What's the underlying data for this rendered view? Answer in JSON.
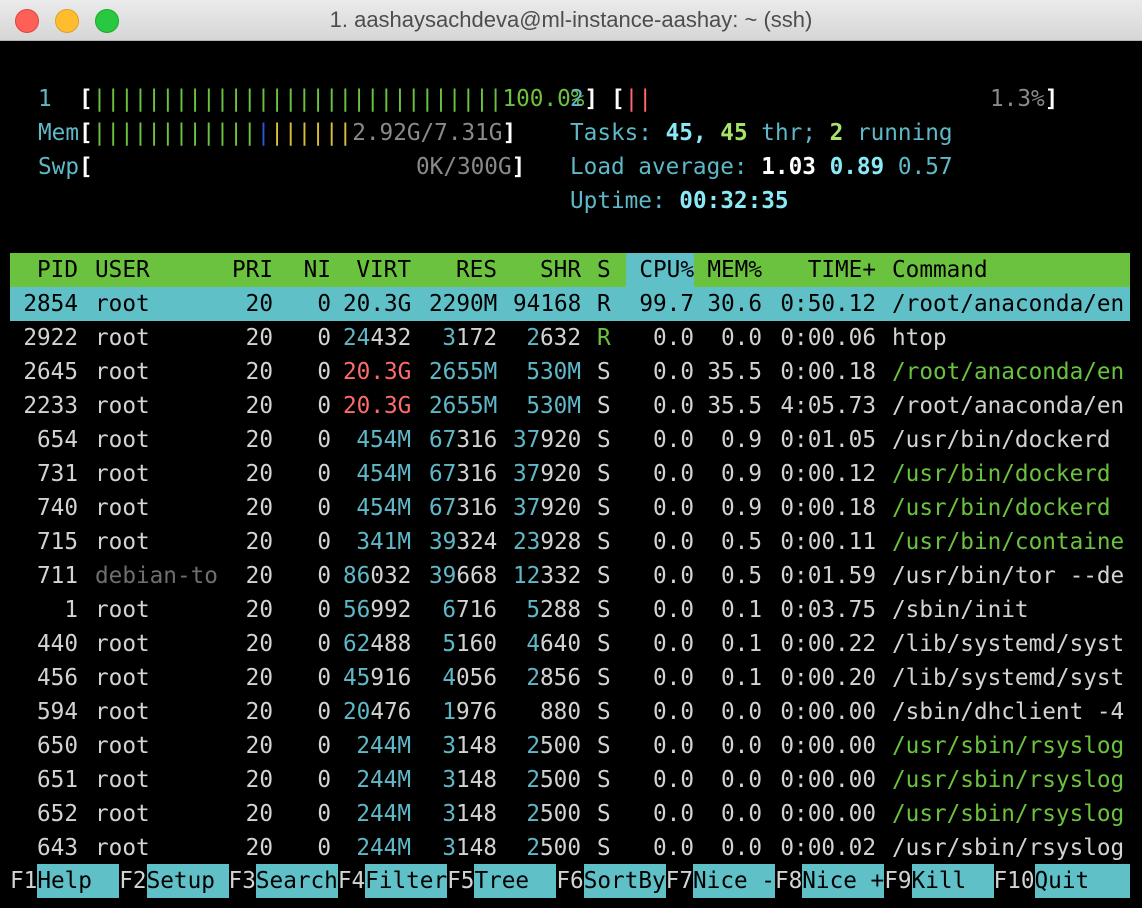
{
  "window": {
    "title": "1. aashaysachdeva@ml-instance-aashay: ~ (ssh)"
  },
  "meters": {
    "cpu1": {
      "label": "1",
      "bars": "||||||||||||||||||||||||||||||",
      "value": "100.0%"
    },
    "cpu2": {
      "label": "2",
      "bars": "||",
      "value": "1.3%"
    },
    "mem": {
      "label": "Mem",
      "bars_green": "||||||||||||",
      "bars_blue": "|",
      "bars_yellow": "||||||",
      "value": "2.92G/7.31G"
    },
    "swp": {
      "label": "Swp",
      "value": "0K/300G"
    },
    "tasks": {
      "label": "Tasks:",
      "count": "45,",
      "threads": "45",
      "thr_label": "thr;",
      "running": "2",
      "running_label": "running"
    },
    "load": {
      "label": "Load average:",
      "v1": "1.03",
      "v5": "0.89",
      "v15": "0.57"
    },
    "uptime": {
      "label": "Uptime:",
      "value": "00:32:35"
    }
  },
  "columns": [
    "PID",
    "USER",
    "PRI",
    "NI",
    "VIRT",
    "RES",
    "SHR",
    "S",
    "CPU%",
    "MEM%",
    "TIME+",
    "Command"
  ],
  "processes": [
    {
      "pid": "2854",
      "user": "root",
      "pri": "20",
      "ni": "0",
      "virt": "20.3G",
      "res": "2290M",
      "shr": "94168",
      "s": "R",
      "cpu": "99.7",
      "mem": "30.6",
      "time": "0:50.12",
      "cmd": "/root/anaconda/en"
    },
    {
      "pid": "2922",
      "user": "root",
      "pri": "20",
      "ni": "0",
      "virt": "24432",
      "res": "3172",
      "shr": "2632",
      "s": "R",
      "cpu": "0.0",
      "mem": "0.0",
      "time": "0:00.06",
      "cmd": "htop"
    },
    {
      "pid": "2645",
      "user": "root",
      "pri": "20",
      "ni": "0",
      "virt": "20.3G",
      "res": "2655M",
      "shr": "530M",
      "s": "S",
      "cpu": "0.0",
      "mem": "35.5",
      "time": "0:00.18",
      "cmd": "/root/anaconda/en"
    },
    {
      "pid": "2233",
      "user": "root",
      "pri": "20",
      "ni": "0",
      "virt": "20.3G",
      "res": "2655M",
      "shr": "530M",
      "s": "S",
      "cpu": "0.0",
      "mem": "35.5",
      "time": "4:05.73",
      "cmd": "/root/anaconda/en"
    },
    {
      "pid": "654",
      "user": "root",
      "pri": "20",
      "ni": "0",
      "virt": "454M",
      "res": "67316",
      "shr": "37920",
      "s": "S",
      "cpu": "0.0",
      "mem": "0.9",
      "time": "0:01.05",
      "cmd": "/usr/bin/dockerd"
    },
    {
      "pid": "731",
      "user": "root",
      "pri": "20",
      "ni": "0",
      "virt": "454M",
      "res": "67316",
      "shr": "37920",
      "s": "S",
      "cpu": "0.0",
      "mem": "0.9",
      "time": "0:00.12",
      "cmd": "/usr/bin/dockerd"
    },
    {
      "pid": "740",
      "user": "root",
      "pri": "20",
      "ni": "0",
      "virt": "454M",
      "res": "67316",
      "shr": "37920",
      "s": "S",
      "cpu": "0.0",
      "mem": "0.9",
      "time": "0:00.18",
      "cmd": "/usr/bin/dockerd"
    },
    {
      "pid": "715",
      "user": "root",
      "pri": "20",
      "ni": "0",
      "virt": "341M",
      "res": "39324",
      "shr": "23928",
      "s": "S",
      "cpu": "0.0",
      "mem": "0.5",
      "time": "0:00.11",
      "cmd": "/usr/bin/containe"
    },
    {
      "pid": "711",
      "user": "debian-to",
      "pri": "20",
      "ni": "0",
      "virt": "86032",
      "res": "39668",
      "shr": "12332",
      "s": "S",
      "cpu": "0.0",
      "mem": "0.5",
      "time": "0:01.59",
      "cmd": "/usr/bin/tor --de"
    },
    {
      "pid": "1",
      "user": "root",
      "pri": "20",
      "ni": "0",
      "virt": "56992",
      "res": "6716",
      "shr": "5288",
      "s": "S",
      "cpu": "0.0",
      "mem": "0.1",
      "time": "0:03.75",
      "cmd": "/sbin/init"
    },
    {
      "pid": "440",
      "user": "root",
      "pri": "20",
      "ni": "0",
      "virt": "62488",
      "res": "5160",
      "shr": "4640",
      "s": "S",
      "cpu": "0.0",
      "mem": "0.1",
      "time": "0:00.22",
      "cmd": "/lib/systemd/syst"
    },
    {
      "pid": "456",
      "user": "root",
      "pri": "20",
      "ni": "0",
      "virt": "45916",
      "res": "4056",
      "shr": "2856",
      "s": "S",
      "cpu": "0.0",
      "mem": "0.1",
      "time": "0:00.20",
      "cmd": "/lib/systemd/syst"
    },
    {
      "pid": "594",
      "user": "root",
      "pri": "20",
      "ni": "0",
      "virt": "20476",
      "res": "1976",
      "shr": "880",
      "s": "S",
      "cpu": "0.0",
      "mem": "0.0",
      "time": "0:00.00",
      "cmd": "/sbin/dhclient -4"
    },
    {
      "pid": "650",
      "user": "root",
      "pri": "20",
      "ni": "0",
      "virt": "244M",
      "res": "3148",
      "shr": "2500",
      "s": "S",
      "cpu": "0.0",
      "mem": "0.0",
      "time": "0:00.00",
      "cmd": "/usr/sbin/rsyslog"
    },
    {
      "pid": "651",
      "user": "root",
      "pri": "20",
      "ni": "0",
      "virt": "244M",
      "res": "3148",
      "shr": "2500",
      "s": "S",
      "cpu": "0.0",
      "mem": "0.0",
      "time": "0:00.00",
      "cmd": "/usr/sbin/rsyslog"
    },
    {
      "pid": "652",
      "user": "root",
      "pri": "20",
      "ni": "0",
      "virt": "244M",
      "res": "3148",
      "shr": "2500",
      "s": "S",
      "cpu": "0.0",
      "mem": "0.0",
      "time": "0:00.00",
      "cmd": "/usr/sbin/rsyslog"
    },
    {
      "pid": "643",
      "user": "root",
      "pri": "20",
      "ni": "0",
      "virt": "244M",
      "res": "3148",
      "shr": "2500",
      "s": "S",
      "cpu": "0.0",
      "mem": "0.0",
      "time": "0:00.02",
      "cmd": "/usr/sbin/rsyslog"
    }
  ],
  "function_keys": [
    {
      "key": "F1",
      "label": "Help"
    },
    {
      "key": "F2",
      "label": "Setup"
    },
    {
      "key": "F3",
      "label": "Search"
    },
    {
      "key": "F4",
      "label": "Filter"
    },
    {
      "key": "F5",
      "label": "Tree"
    },
    {
      "key": "F6",
      "label": "SortBy"
    },
    {
      "key": "F7",
      "label": "Nice -"
    },
    {
      "key": "F8",
      "label": "Nice +"
    },
    {
      "key": "F9",
      "label": "Kill"
    },
    {
      "key": "F10",
      "label": "Quit"
    }
  ],
  "colors": {
    "accent_green": "#6bc23e",
    "accent_cyan": "#5fc0c8",
    "highlight_red": "#ff6b6b"
  }
}
